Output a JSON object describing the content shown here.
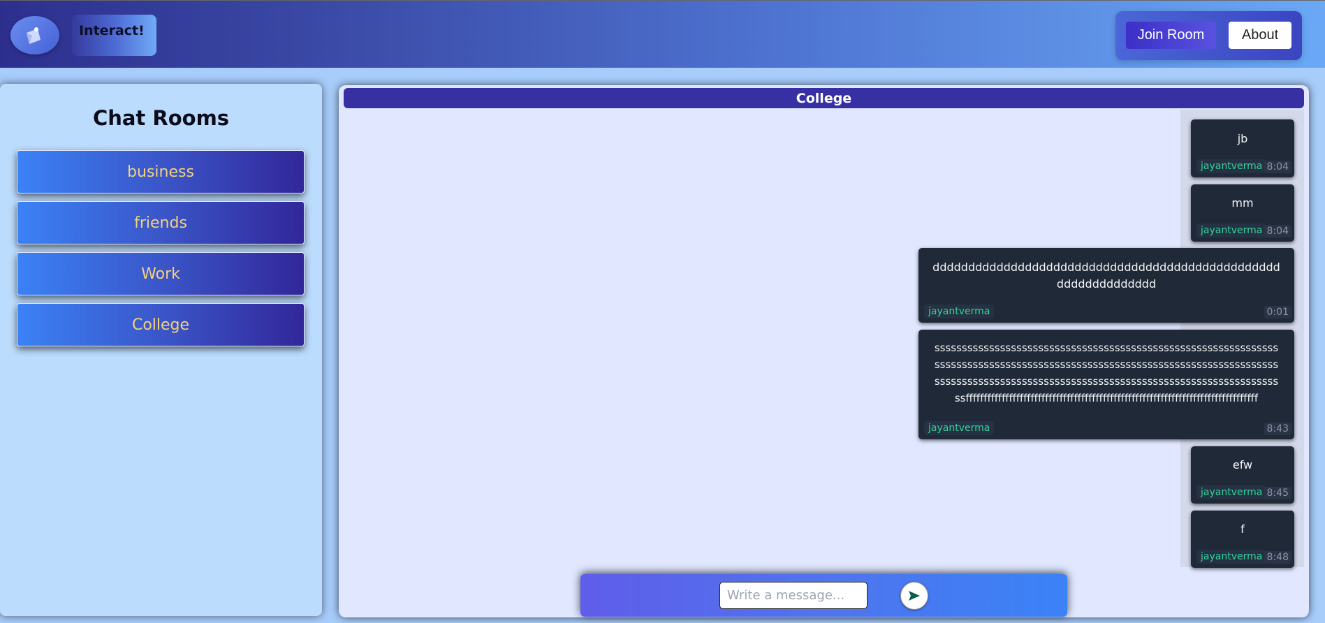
{
  "header": {
    "logo_text": "Interact!",
    "nav": {
      "join_room_label": "Join Room",
      "about_label": "About"
    }
  },
  "sidebar": {
    "title": "Chat Rooms",
    "rooms": [
      {
        "label": "business"
      },
      {
        "label": "friends"
      },
      {
        "label": "Work"
      },
      {
        "label": "College"
      }
    ]
  },
  "chat": {
    "room_title": "College",
    "messages": [
      {
        "text": "jb",
        "user": "jayantverma",
        "time": "8:04"
      },
      {
        "text": "mm",
        "user": "jayantverma",
        "time": "8:04"
      },
      {
        "text": "ddddddddddddddddddddddddddddddddddddddddddddddddddddddddddddddd",
        "user": "jayantverma",
        "time": "0:01"
      },
      {
        "text": "sssssssssssssssssssssssssssssssssssssssssssssssssssssssssssssssssssssssssssssssssssssssssssssssssssssssssssssssssssssssssssssssssssssssssssssssssssssssssssssssssssssssssssssssssssssssssssssssfffffffffffffffffffffffffffffffffffffffffffffffffffffffffffffffffffffffffffffffff",
        "user": "jayantverma",
        "time": "8:43"
      },
      {
        "text": "efw",
        "user": "jayantverma",
        "time": "8:45"
      },
      {
        "text": "f",
        "user": "jayantverma",
        "time": "8:48"
      }
    ]
  },
  "composer": {
    "placeholder": "Write a message...",
    "send_icon": "send-arrow-icon"
  },
  "colors": {
    "room_label": "#f5d27a",
    "chat_title_bg": "#3730a3",
    "message_bg": "#1f2937",
    "username": "#34d399"
  }
}
